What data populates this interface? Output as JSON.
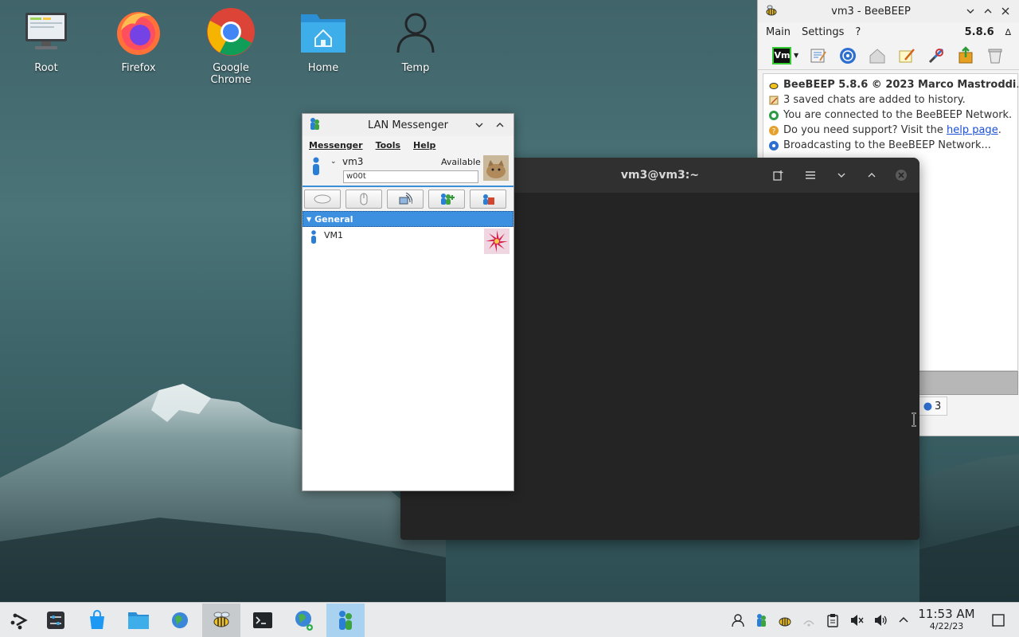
{
  "desktop": {
    "icons": [
      {
        "label": "Root"
      },
      {
        "label": "Firefox"
      },
      {
        "label": "Google Chrome"
      },
      {
        "label": "Home"
      },
      {
        "label": "Temp"
      }
    ]
  },
  "beebeep": {
    "title": "vm3 - BeeBEEP",
    "menu": [
      "Main",
      "Settings",
      "?"
    ],
    "version": "5.8.6",
    "toolbar_badge": "Vm",
    "log": [
      {
        "text": "BeeBEEP 5.8.6 © 2023 Marco Mastroddi",
        "suffix": "."
      },
      {
        "text": "3 saved chats are added to history."
      },
      {
        "text": "You are connected to the BeeBEEP Network."
      },
      {
        "text": "Do you need support? Visit the ",
        "link": "help page",
        "suffix": "."
      },
      {
        "text": "Broadcasting to the BeeBEEP Network..."
      }
    ],
    "tab_count": "3"
  },
  "terminal": {
    "title": "vm3@vm3:~"
  },
  "lan_messenger": {
    "title": "LAN Messenger",
    "menu": [
      "Messenger",
      "Tools",
      "Help"
    ],
    "username": "vm3",
    "status": "Available",
    "note": "w00t",
    "group": "General",
    "contacts": [
      {
        "name": "VM1"
      }
    ]
  },
  "taskbar": {
    "time": "11:53 AM",
    "date": "4/22/23"
  },
  "colors": {
    "accent": "#3d8fe0",
    "terminal_bg": "#242424",
    "link": "#1a4fd6"
  }
}
